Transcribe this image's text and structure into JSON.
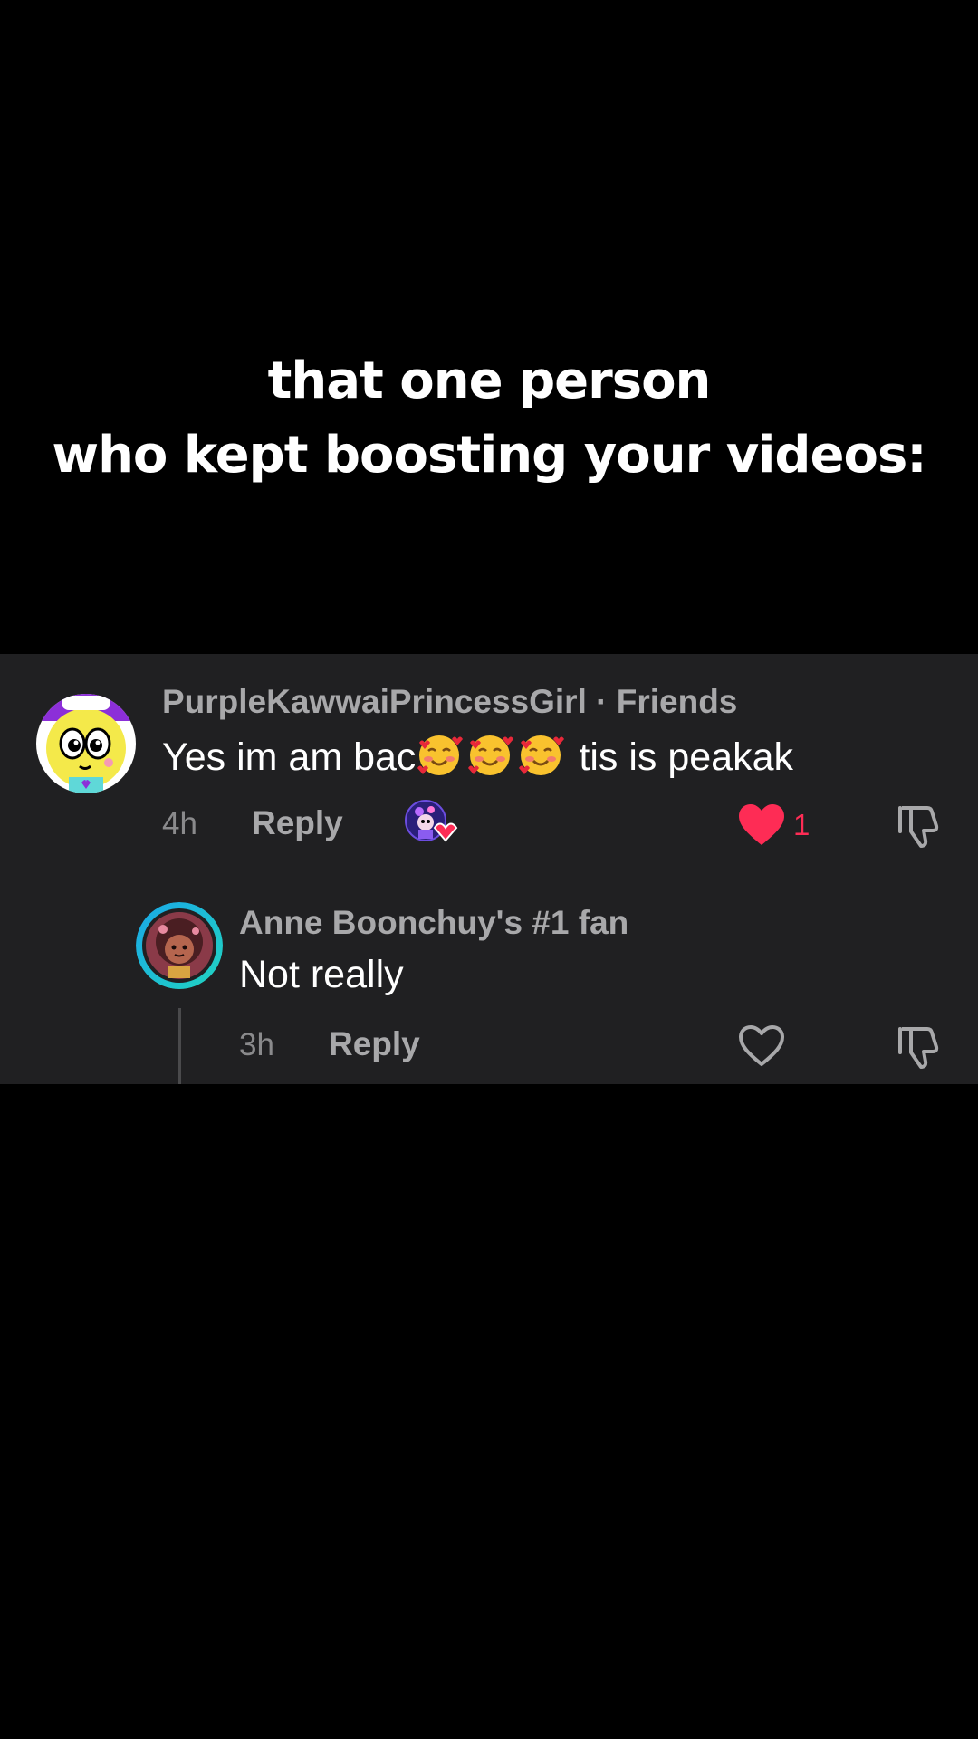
{
  "caption": {
    "line1": "that one person",
    "line2": "who kept boosting your videos:"
  },
  "comments": [
    {
      "username": "PurpleKawwaiPrincessGirl · Friends",
      "text_before": "Yes im am bac",
      "emojis": [
        "smiling-face-with-hearts",
        "smiling-face-with-hearts",
        "smiling-face-with-hearts"
      ],
      "text_after": " tis is peakak",
      "time": "4h",
      "reply_label": "Reply",
      "like_count": "1",
      "liked": true
    },
    {
      "username": "Anne Boonchuy's #1 fan",
      "text": "Not really",
      "time": "3h",
      "reply_label": "Reply",
      "liked": false
    }
  ],
  "colors": {
    "background": "#000000",
    "panel": "#202022",
    "like_red": "#fe2c55",
    "secondary_text": "#a8a8aa"
  }
}
